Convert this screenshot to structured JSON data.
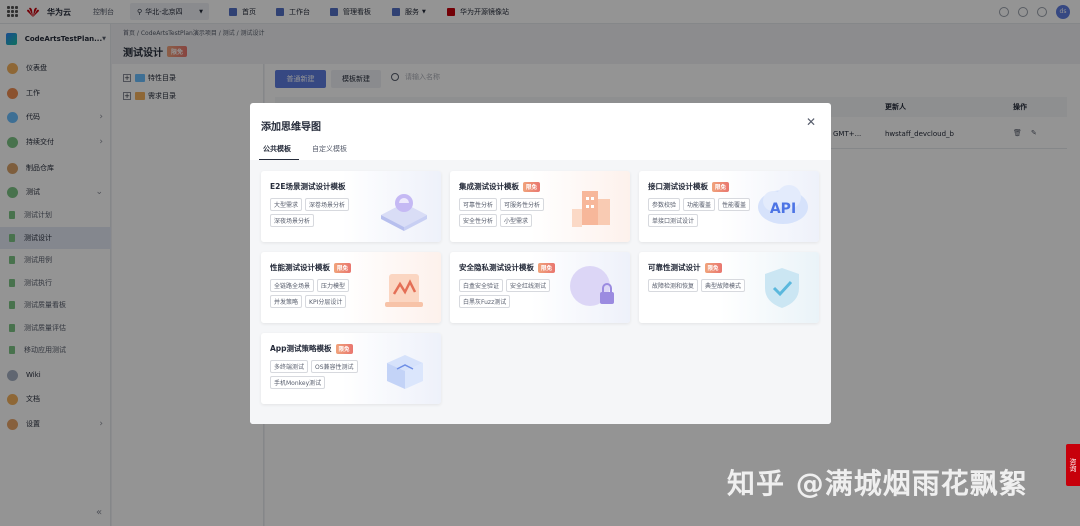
{
  "topbar": {
    "brand": "华为云",
    "console": "控制台",
    "region": "华北-北京四",
    "nav": [
      "首页",
      "工作台",
      "管理看板",
      "服务",
      "华为开源镜像站"
    ],
    "avatar": "ds"
  },
  "sidebar": {
    "project": "CodeArtsTestPlan...",
    "items": [
      {
        "label": "仪表盘"
      },
      {
        "label": "工作"
      },
      {
        "label": "代码"
      },
      {
        "label": "持续交付"
      },
      {
        "label": "制品仓库"
      },
      {
        "label": "测试"
      }
    ],
    "test_sub": [
      "测试计划",
      "测试设计",
      "测试用例",
      "测试执行",
      "测试质量看板",
      "测试质量评估",
      "移动应用测试"
    ],
    "bottom_items": [
      {
        "label": "Wiki"
      },
      {
        "label": "文档"
      },
      {
        "label": "设置"
      }
    ]
  },
  "breadcrumb": "首页 / CodeArtsTestPlan演示项目 / 测试 / 测试设计",
  "page_title": "测试设计",
  "limited_badge": "限免",
  "tree": [
    "特性目录",
    "需求目录"
  ],
  "toolbar": {
    "primary": "普通新建",
    "secondary": "模板新建",
    "search_placeholder": "请输入名称"
  },
  "table": {
    "headers": {
      "updater": "更新人",
      "actions": "操作"
    },
    "row": {
      "time_partial": "GMT+...",
      "updater": "hwstaff_devcloud_b"
    }
  },
  "modal": {
    "title": "添加思维导图",
    "tabs": [
      "公共模板",
      "自定义模板"
    ],
    "cards": [
      {
        "title": "E2E场景测试设计模板",
        "limited": false,
        "tags": [
          "大型需求",
          "深卷场景分析",
          "深夜场景分析"
        ]
      },
      {
        "title": "集成测试设计模板",
        "limited": true,
        "tags": [
          "可靠性分析",
          "可服务性分析",
          "安全性分析",
          "小型需求"
        ]
      },
      {
        "title": "接口测试设计模板",
        "limited": true,
        "tags": [
          "参数校验",
          "功能覆盖",
          "性能覆盖",
          "单接口测试设计"
        ],
        "art_text": "API"
      },
      {
        "title": "性能测试设计模板",
        "limited": true,
        "tags": [
          "全链路全场景",
          "压力模型",
          "并发策略",
          "KPI分层设计"
        ]
      },
      {
        "title": "安全隐私测试设计模板",
        "limited": true,
        "tags": [
          "白盒安全验证",
          "安全红线测试",
          "白黑灰Fuzz测试"
        ]
      },
      {
        "title": "可靠性测试设计",
        "limited": true,
        "tags": [
          "故障检测和恢复",
          "典型故障模式"
        ]
      },
      {
        "title": "App测试策略模板",
        "limited": true,
        "tags": [
          "多终端测试",
          "OS兼容性测试",
          "手机Monkey测试"
        ]
      }
    ]
  },
  "watermark": "知乎 @满城烟雨花飘絮",
  "consult": "咨询"
}
